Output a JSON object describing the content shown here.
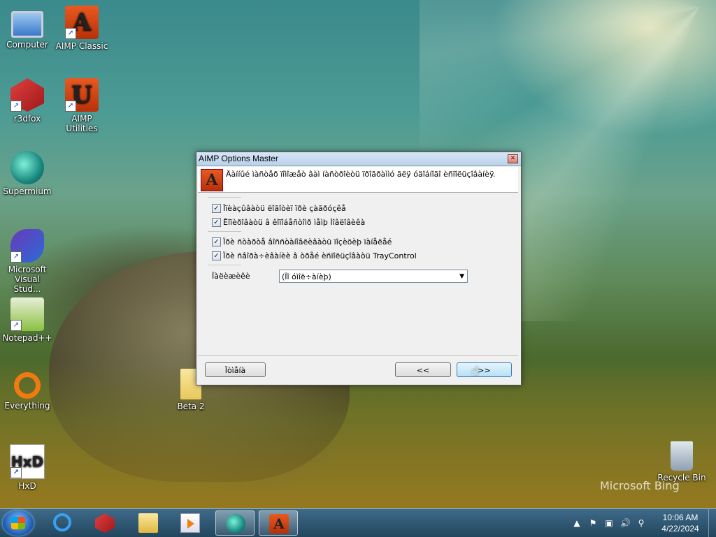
{
  "desktop": {
    "icons": [
      {
        "label": "Computer",
        "icon": "computer-icon",
        "shortcut": false
      },
      {
        "label": "AIMP Classic",
        "icon": "aimp-icon",
        "shortcut": true
      },
      {
        "label": "r3dfox",
        "icon": "r3dfox-icon",
        "shortcut": true
      },
      {
        "label": "AIMP Utilities",
        "icon": "aimp-utilities-icon",
        "shortcut": true
      },
      {
        "label": "Supermium",
        "icon": "supermium-icon",
        "shortcut": false
      },
      {
        "label": "Microsoft Visual Stud...",
        "icon": "visual-studio-icon",
        "shortcut": true
      },
      {
        "label": "Notepad++",
        "icon": "notepadpp-icon",
        "shortcut": true
      },
      {
        "label": "Everything",
        "icon": "everything-icon",
        "shortcut": true
      },
      {
        "label": "HxD",
        "icon": "hxd-icon",
        "shortcut": true
      },
      {
        "label": "Beta 2",
        "icon": "folder-icon",
        "shortcut": false
      },
      {
        "label": "Recycle Bin",
        "icon": "recycle-bin-icon",
        "shortcut": false
      }
    ],
    "watermark": "Microsoft Bing"
  },
  "dialog": {
    "title": "AIMP Options Master",
    "close_glyph": "✕",
    "header_logo": "A",
    "header_text": "Äàííûé ìàñòåð ïîìîæåò âàì íàñòðîèòü ïðîãðàììó äëÿ óäîáíîãî èñïîëüçîâàíèÿ.",
    "checkboxes": [
      {
        "label": "Îïèàçûâàòü ëîãîòèï ïðè çàãðóçêå",
        "checked": true
      },
      {
        "label": "Êîïèðîâàòü â êîïîáåñòîìð ìåìþ Ìîâëîâèêà",
        "checked": true
      },
      {
        "label": "Ïðè ñòàðòå âîññòàíîâëèâàòü ïîçèöèþ ïàíåëåé",
        "checked": true
      },
      {
        "label": "Ïðè ñâîðà÷èâàíèè â òðåé èñïîëüçîâàòü TrayControl",
        "checked": true
      }
    ],
    "check_glyph": "✓",
    "language_label": "Ïàëèæèêè",
    "language_value": "(Ïî óìîë÷àíèþ)",
    "dropdown_arrow": "▼",
    "buttons": {
      "cancel": "Îòìåíà",
      "back": "<<",
      "next": ">>"
    }
  },
  "taskbar": {
    "apps": [
      "internet-explorer",
      "r3dfox",
      "file-explorer",
      "media-player",
      "supermium",
      "aimp"
    ],
    "tray_icons": [
      "▲",
      "⚑",
      "▣",
      "🔊",
      "⚲"
    ],
    "time": "10:06 AM",
    "date": "4/22/2024"
  }
}
